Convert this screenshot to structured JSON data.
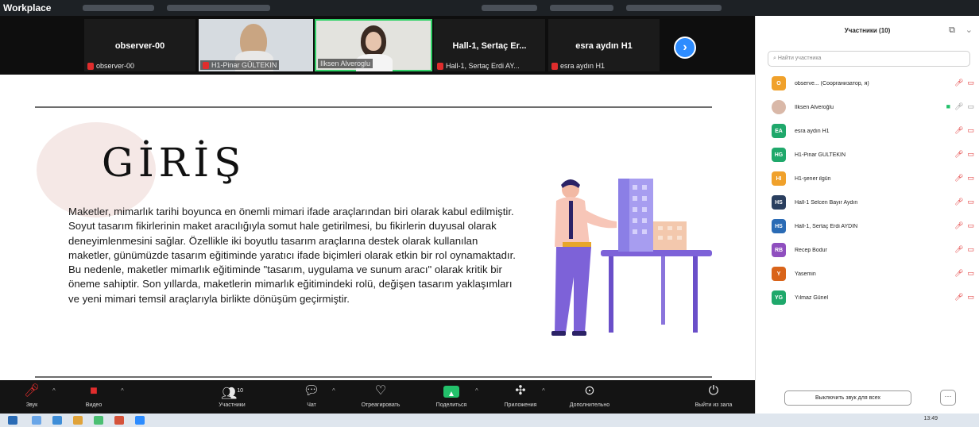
{
  "window": {
    "app_title": "Workplace"
  },
  "gallery": {
    "tiles": [
      {
        "name": "observer-00",
        "label": "observer-00",
        "video": false
      },
      {
        "name": "",
        "label": "H1-Pinar GÜLTEKIN",
        "video": true
      },
      {
        "name": "",
        "label": "Ilksen Alveroglu",
        "video": true,
        "active": true
      },
      {
        "name": "Hall-1, Sertaç Er...",
        "label": "Hall-1, Sertaç Erdi AY...",
        "video": false
      },
      {
        "name": "esra aydın H1",
        "label": "esra aydın H1",
        "video": false
      }
    ],
    "next_glyph": "›"
  },
  "slide": {
    "title": "GİRİŞ",
    "body": "Maketler, mimarlık tarihi boyunca en önemli mimari ifade araçlarından biri olarak kabul edilmiştir. Soyut tasarım fikirlerinin maket aracılığıyla somut hale getirilmesi, bu fikirlerin duyusal olarak deneyimlenmesini sağlar. Özellikle iki boyutlu tasarım araçlarına destek olarak kullanılan maketler, günümüzde tasarım eğitiminde yaratıcı ifade biçimleri olarak etkin bir rol oynamaktadır. Bu nedenle, maketler mimarlık eğitiminde \"tasarım, uygulama ve sunum aracı\" olarak kritik bir öneme sahiptir. Son yıllarda, maketlerin mimarlık eğitimindeki rolü, değişen tasarım yaklaşımları ve yeni mimari temsil araçlarıyla birlikte dönüşüm geçirmiştir."
  },
  "toolbar": {
    "mute_label": "Звук",
    "video_label": "Видео",
    "participants_label": "Участники",
    "participants_count": "10",
    "chat_label": "Чат",
    "react_label": "Отреагировать",
    "share_label": "Поделиться",
    "apps_label": "Приложения",
    "more_label": "Дополнительно",
    "leave_label": "Выйти из зала"
  },
  "panel": {
    "title": "Участники (10)",
    "search_placeholder": "Найти участника",
    "participants": [
      {
        "initials": "O",
        "name": "observe... (Соорганизатор, я)",
        "color": "#f0a12b",
        "video_on": false
      },
      {
        "initials": "",
        "name": "Ilksen Alveroğlu",
        "color": "#d9b8a8",
        "video_on": true,
        "photo": true
      },
      {
        "initials": "EA",
        "name": "esra aydın H1",
        "color": "#1fa86b",
        "video_on": false
      },
      {
        "initials": "HG",
        "name": "H1-Pinar GÜLTEKIN",
        "color": "#1fa86b",
        "video_on": false
      },
      {
        "initials": "HI",
        "name": "H1-şener ilgün",
        "color": "#f0a12b",
        "video_on": false
      },
      {
        "initials": "HS",
        "name": "Hall-1 Selcen Bayır Aydın",
        "color": "#2a3f5f",
        "video_on": false
      },
      {
        "initials": "HS",
        "name": "Hall-1, Sertaç Erdi AYDIN",
        "color": "#2a6bb5",
        "video_on": false
      },
      {
        "initials": "RB",
        "name": "Recep Bodur",
        "color": "#8f4fbf",
        "video_on": false
      },
      {
        "initials": "Y",
        "name": "Yasemin",
        "color": "#d9641a",
        "video_on": false
      },
      {
        "initials": "YG",
        "name": "Yılmaz Günel",
        "color": "#1fa86b",
        "video_on": false
      }
    ],
    "mute_all_label": "Выключить звук для всех",
    "more_glyph": "···"
  },
  "taskbar": {
    "clock": "13:49"
  }
}
